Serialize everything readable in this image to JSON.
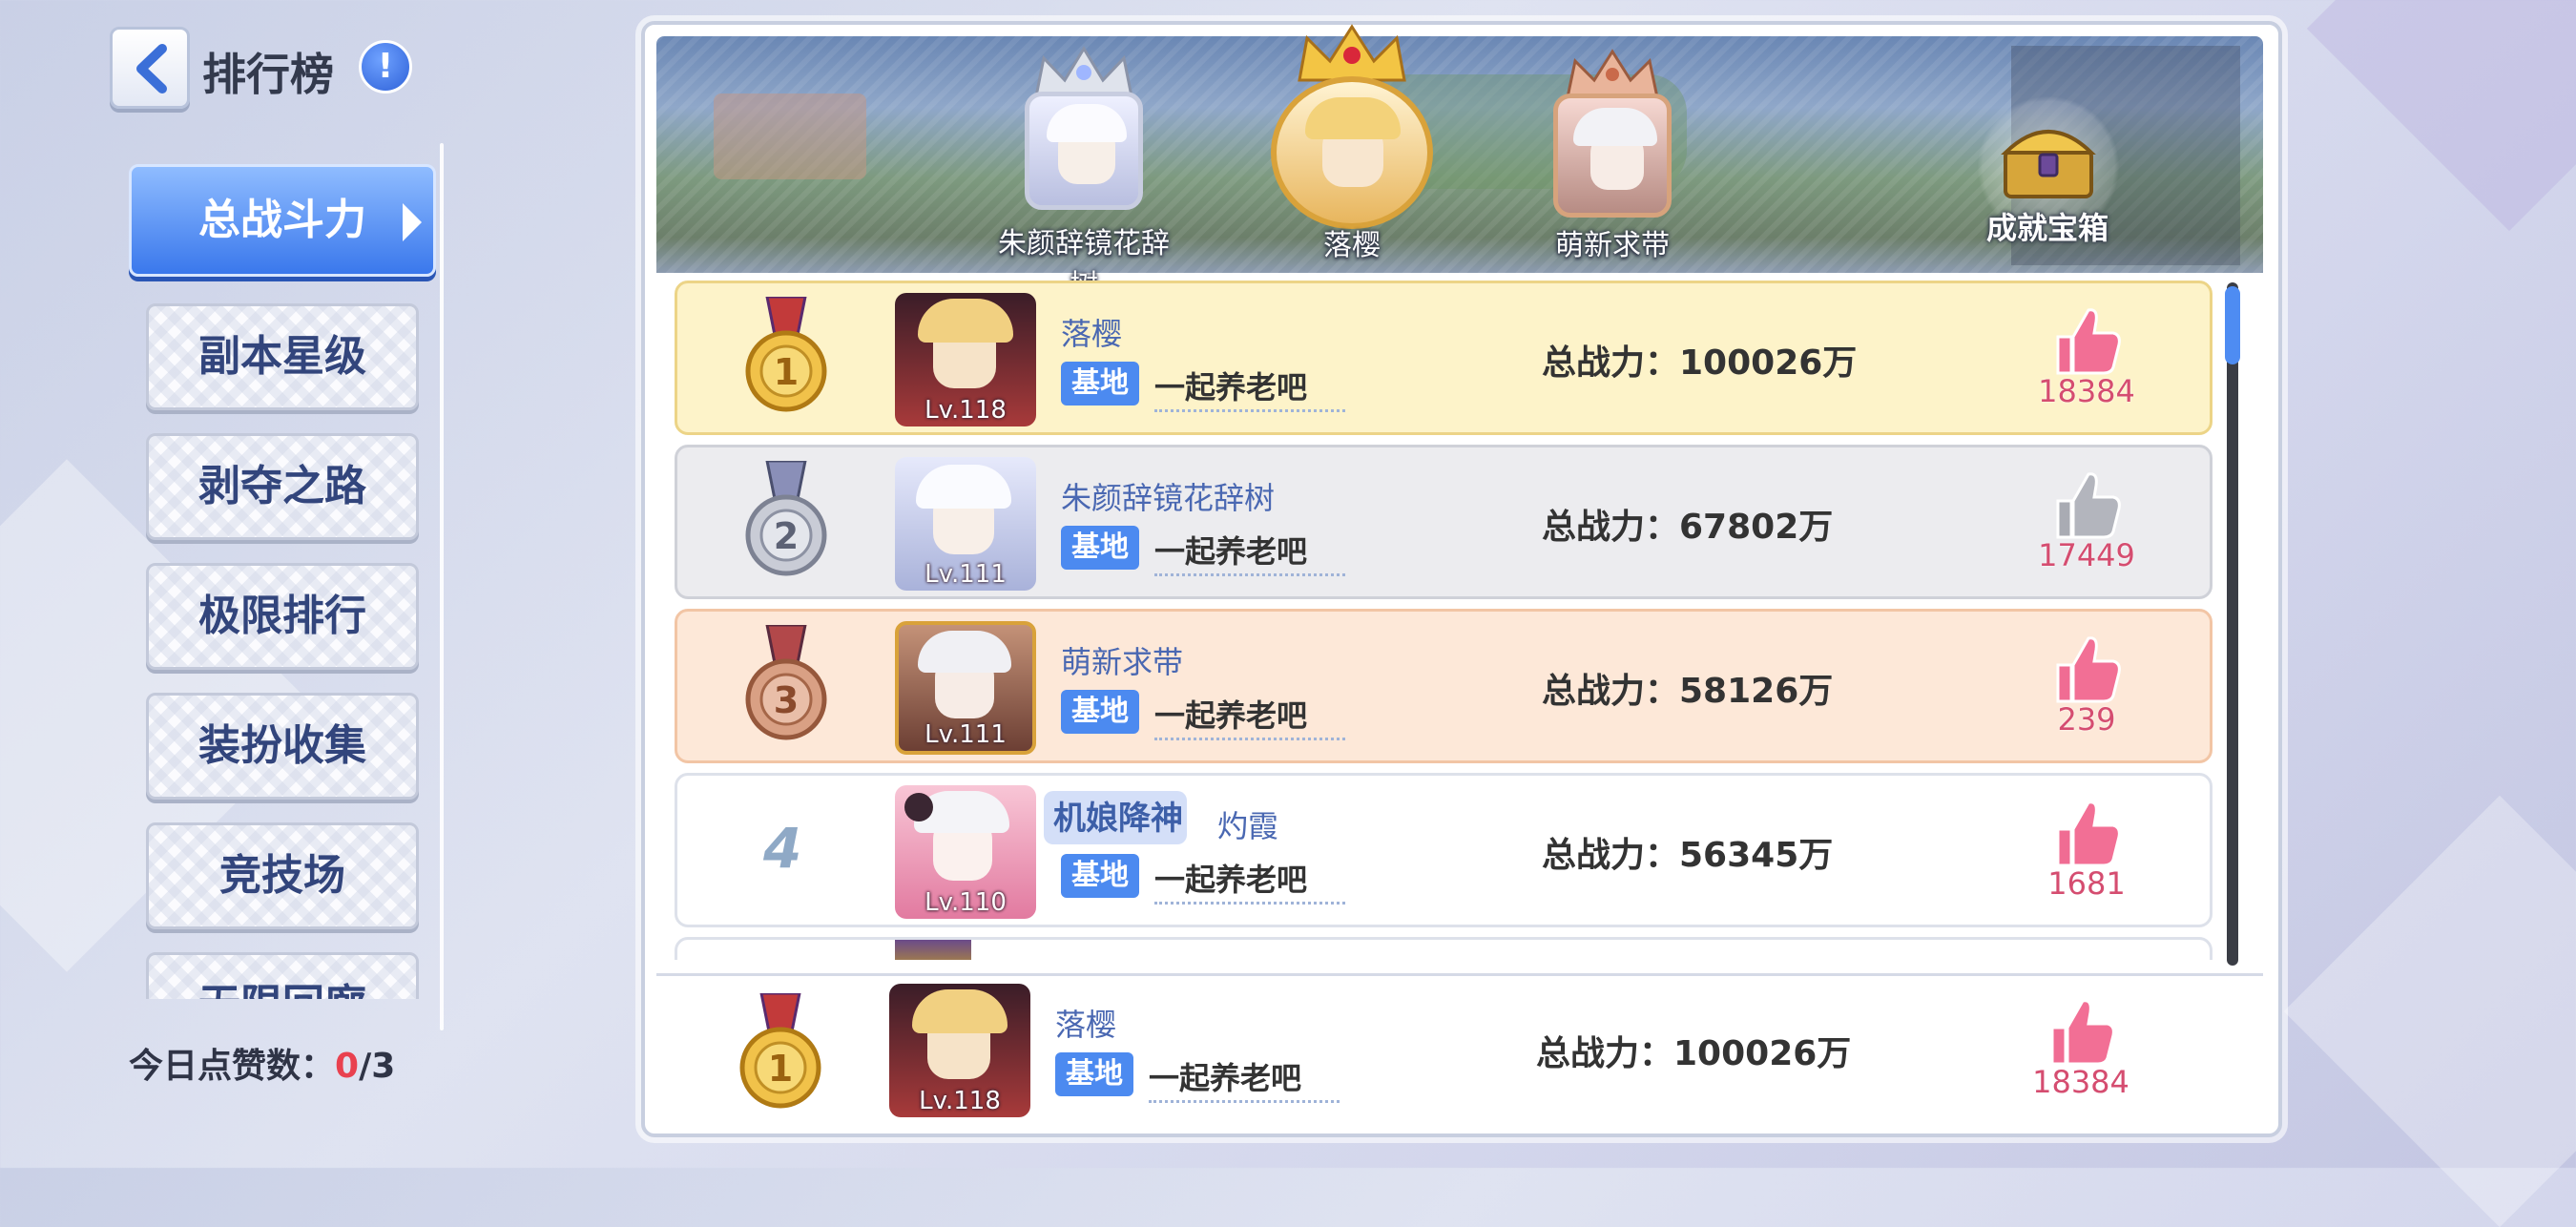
{
  "header": {
    "title": "排行榜",
    "back_icon": "chevron-left-icon",
    "info_icon": "exclamation-icon",
    "info_text": "!"
  },
  "nav": {
    "items": [
      {
        "label": "总战斗力",
        "active": true
      },
      {
        "label": "副本星级"
      },
      {
        "label": "剥夺之路"
      },
      {
        "label": "极限排行"
      },
      {
        "label": "装扮收集"
      },
      {
        "label": "竞技场"
      },
      {
        "label": "无限回廊"
      }
    ]
  },
  "likes_today": {
    "label": "今日点赞数：",
    "used": "0",
    "total": "/3"
  },
  "podium": {
    "first": {
      "name": "落樱"
    },
    "second": {
      "name": "朱颜辞镜花辞树"
    },
    "third": {
      "name": "萌新求带"
    },
    "chest_label": "成就宝箱"
  },
  "rankings": [
    {
      "rank": "1",
      "name": "落樱",
      "level": "Lv.118",
      "tag": "基地",
      "guild": "一起养老吧",
      "power": "总战力：100026万",
      "likes": "18384"
    },
    {
      "rank": "2",
      "name": "朱颜辞镜花辞树",
      "level": "Lv.111",
      "tag": "基地",
      "guild": "一起养老吧",
      "power": "总战力：67802万",
      "likes": "17449"
    },
    {
      "rank": "3",
      "name": "萌新求带",
      "level": "Lv.111",
      "tag": "基地",
      "guild": "一起养老吧",
      "power": "总战力：58126万",
      "likes": "239"
    },
    {
      "rank": "4",
      "name": "灼霞",
      "level": "Lv.110",
      "tag": "基地",
      "guild": "一起养老吧",
      "power": "总战力：56345万",
      "likes": "1681",
      "guild_logo": "机娘降神"
    }
  ],
  "self": {
    "rank": "1",
    "name": "落樱",
    "level": "Lv.118",
    "tag": "基地",
    "guild": "一起养老吧",
    "power": "总战力：100026万",
    "likes": "18384"
  },
  "colors": {
    "accent": "#3a78ec",
    "gold_row": "#fdf3c9",
    "silver_row": "#ececef",
    "bronze_row": "#fde8d8",
    "like_pink": "#d54d70"
  }
}
